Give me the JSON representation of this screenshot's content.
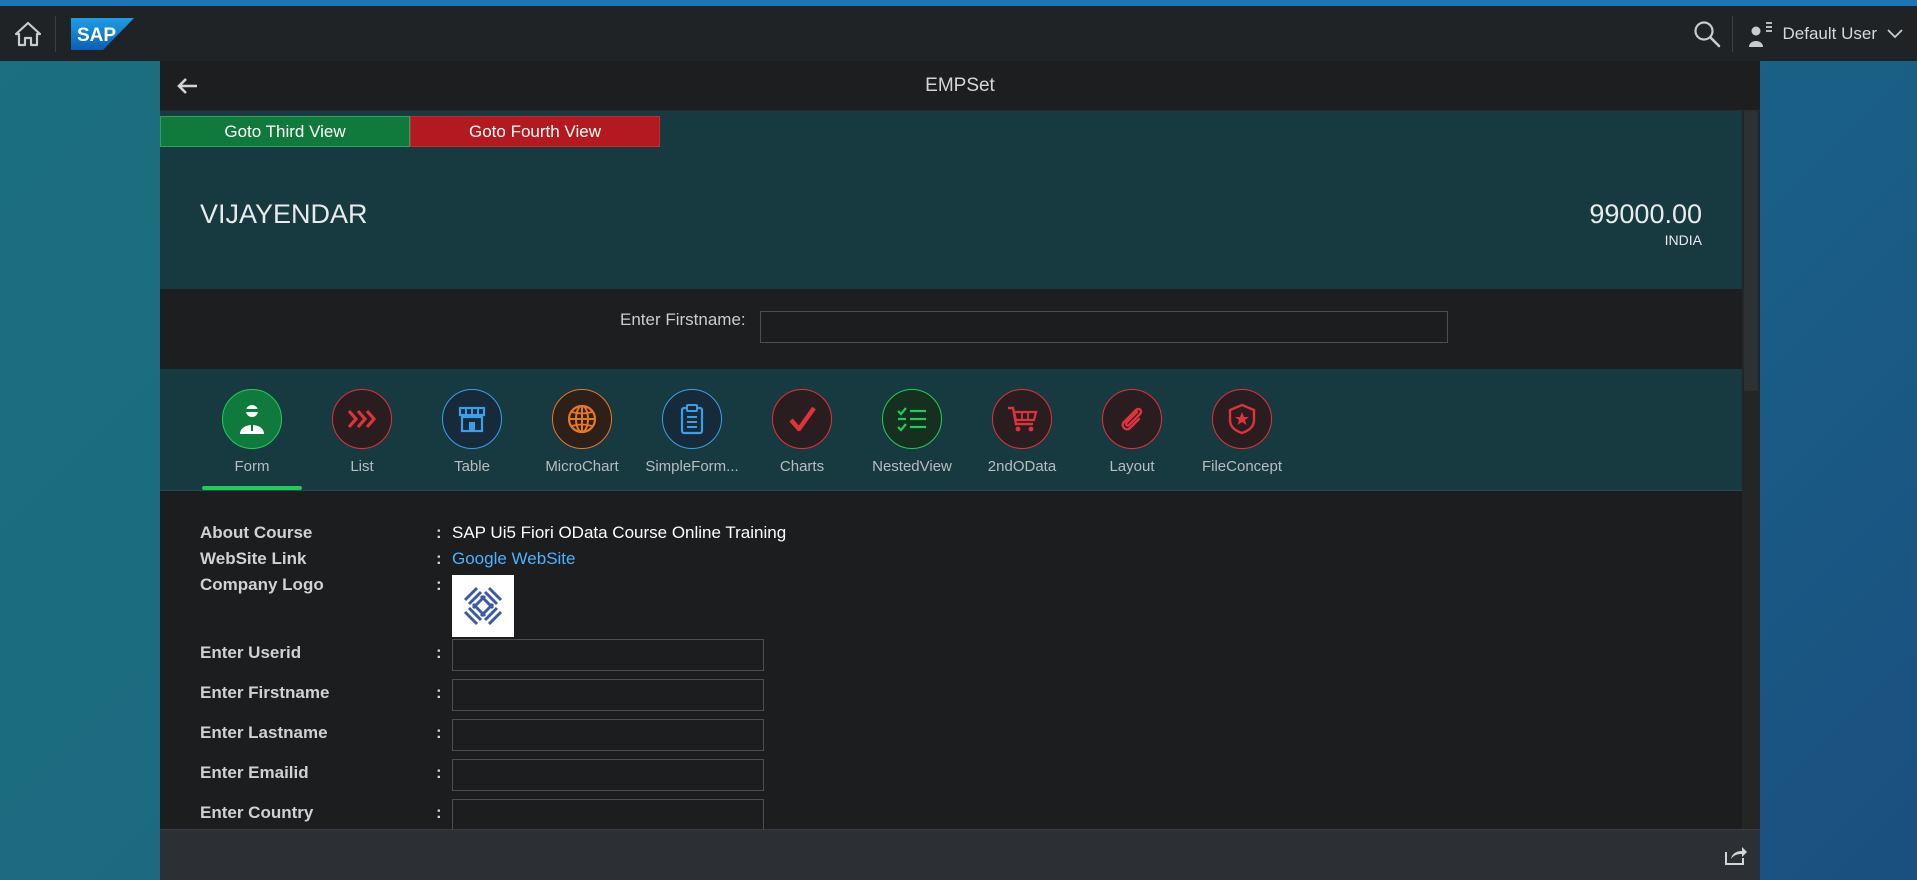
{
  "shell": {
    "user_name": "Default User",
    "logo_text": "SAP"
  },
  "app": {
    "title": "EMPSet"
  },
  "buttons": {
    "goto_third": "Goto Third View",
    "goto_fourth": "Goto Fourth View"
  },
  "object_header": {
    "title": "VIJAYENDAR",
    "number": "99000.00",
    "unit": "INDIA"
  },
  "filter": {
    "label": "Enter Firstname:",
    "value": ""
  },
  "tabs": [
    {
      "label": "Form",
      "icon": "employee-icon",
      "color": "#1fce5a"
    },
    {
      "label": "List",
      "icon": "chevron-right-triple-icon",
      "color": "#e0323b"
    },
    {
      "label": "Table",
      "icon": "store-icon",
      "color": "#3b9ee8"
    },
    {
      "label": "MicroChart",
      "icon": "globe-icon",
      "color": "#e87722"
    },
    {
      "label": "SimpleForm...",
      "icon": "clipboard-icon",
      "color": "#3b9ee8"
    },
    {
      "label": "Charts",
      "icon": "checkmark-icon",
      "color": "#e0323b"
    },
    {
      "label": "NestedView",
      "icon": "checklist-icon",
      "color": "#1fce5a"
    },
    {
      "label": "2ndOData",
      "icon": "cart-icon",
      "color": "#e0323b"
    },
    {
      "label": "Layout",
      "icon": "paperclip-icon",
      "color": "#e0323b"
    },
    {
      "label": "FileConcept",
      "icon": "badge-icon",
      "color": "#e0323b"
    }
  ],
  "form": {
    "about_course_label": "About Course",
    "about_course_value": "SAP Ui5 Fiori OData Course Online Training",
    "website_label": "WebSite Link",
    "website_value": "Google WebSite",
    "logo_label": "Company Logo",
    "userid_label": "Enter Userid",
    "firstname_label": "Enter Firstname",
    "lastname_label": "Enter Lastname",
    "emailid_label": "Enter Emailid",
    "country_label": "Enter Country",
    "colon": ":"
  },
  "colors": {
    "shell_bg": "#1f2326",
    "header_bg": "#173a40",
    "accent_green": "#1fce5a",
    "btn_green": "#0f7a3c",
    "btn_red": "#b3191f",
    "link": "#4db1ff"
  }
}
